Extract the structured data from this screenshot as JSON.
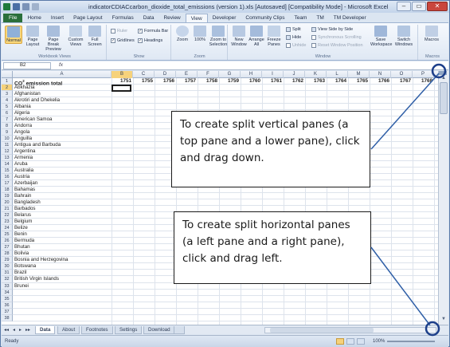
{
  "window": {
    "title": "indicatorCDIACcarbon_dioxide_total_emissions (version 1).xls [Autosaved]  [Compatibility Mode]  -  Microsoft Excel",
    "controls": [
      "–",
      "▭",
      "✕"
    ]
  },
  "ribbon": {
    "tabs": [
      "File",
      "Home",
      "Insert",
      "Page Layout",
      "Formulas",
      "Data",
      "Review",
      "View",
      "Developer",
      "Community Clips",
      "Team",
      "TM",
      "TM Developer"
    ],
    "active_tab": "View",
    "groups": {
      "workbook_views": {
        "label": "Workbook Views",
        "buttons": [
          "Normal",
          "Page Layout",
          "Page Break Preview",
          "Custom Views",
          "Full Screen"
        ]
      },
      "show": {
        "label": "Show",
        "items": [
          "Ruler",
          "Formula Bar",
          "Gridlines",
          "Headings"
        ]
      },
      "zoom": {
        "label": "Zoom",
        "buttons": [
          "Zoom",
          "100%",
          "Zoom to Selection"
        ]
      },
      "window": {
        "label": "Window",
        "buttons": [
          "New Window",
          "Arrange All",
          "Freeze Panes"
        ],
        "small": [
          "Split",
          "Hide",
          "Unhide",
          "View Side by Side",
          "Synchronous Scrolling",
          "Reset Window Position"
        ],
        "after": [
          "Save Workspace",
          "Switch Windows"
        ]
      },
      "macros": {
        "label": "Macros",
        "buttons": [
          "Macros"
        ]
      }
    }
  },
  "formula_bar": {
    "name_box": "B2",
    "fx": "fx",
    "value": ""
  },
  "sheet": {
    "columns": [
      "A",
      "B",
      "C",
      "D",
      "E",
      "F",
      "G",
      "H",
      "I",
      "J",
      "K",
      "L",
      "M",
      "N",
      "O",
      "P"
    ],
    "header_label": "CO",
    "header_sup": "2",
    "header_rest": " emission total",
    "years": [
      "1751",
      "1755",
      "1756",
      "1757",
      "1758",
      "1759",
      "1760",
      "1761",
      "1762",
      "1763",
      "1764",
      "1765",
      "1766",
      "1767",
      "1768"
    ],
    "row_numbers": [
      "1",
      "2",
      "3",
      "4",
      "5",
      "6",
      "7",
      "8",
      "9",
      "10",
      "11",
      "12",
      "13",
      "14",
      "15",
      "16",
      "17",
      "18",
      "19",
      "20",
      "21",
      "22",
      "23",
      "24",
      "25",
      "26",
      "27",
      "28",
      "29",
      "30",
      "31",
      "32",
      "33",
      "34",
      "35",
      "36",
      "37",
      "38"
    ],
    "countries": [
      "Abkhazia",
      "Afghanistan",
      "Akrotiri and Dhekelia",
      "Albania",
      "Algeria",
      "American Samoa",
      "Andorra",
      "Angola",
      "Anguilla",
      "Antigua and Barbuda",
      "Argentina",
      "Armenia",
      "Aruba",
      "Australia",
      "Austria",
      "Azerbaijan",
      "Bahamas",
      "Bahrain",
      "Bangladesh",
      "Barbados",
      "Belarus",
      "Belgium",
      "Belize",
      "Benin",
      "Bermuda",
      "Bhutan",
      "Bolivia",
      "Bosnia and Herzegovina",
      "Botswana",
      "Brazil",
      "British Virgin Islands",
      "Brunei"
    ],
    "active_cell": "B2"
  },
  "sheet_tabs": {
    "nav": [
      "◂◂",
      "◂",
      "▸",
      "▸▸"
    ],
    "tabs": [
      "Data",
      "About",
      "Footnotes",
      "Settings",
      "Download"
    ],
    "active": "Data"
  },
  "status_bar": {
    "ready": "Ready",
    "zoom": "100%"
  },
  "callouts": {
    "vertical": "To create split vertical panes (a top pane and a lower pane), click and drag down.",
    "horizontal": "To create split horizontal panes (a left pane and a right pane), click and drag left."
  }
}
